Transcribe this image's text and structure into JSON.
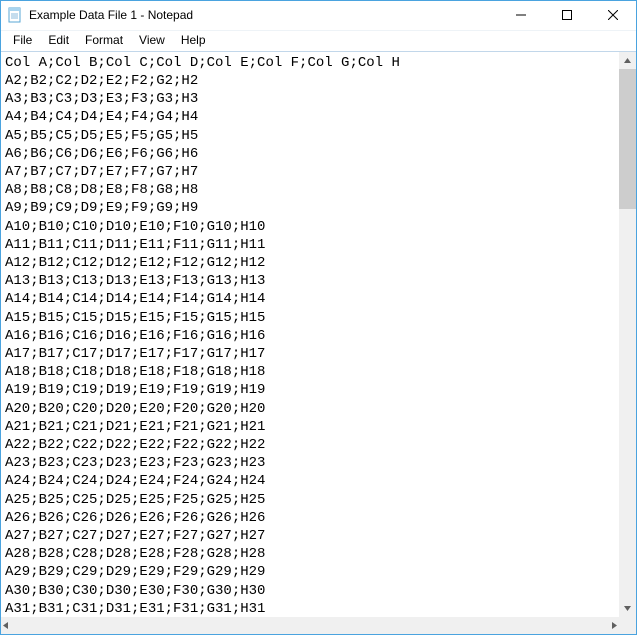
{
  "window": {
    "title": "Example Data File 1 - Notepad"
  },
  "menu": {
    "file": "File",
    "edit": "Edit",
    "format": "Format",
    "view": "View",
    "help": "Help"
  },
  "document": {
    "header": "Col A;Col B;Col C;Col D;Col E;Col F;Col G;Col H",
    "rows": [
      "A2;B2;C2;D2;E2;F2;G2;H2",
      "A3;B3;C3;D3;E3;F3;G3;H3",
      "A4;B4;C4;D4;E4;F4;G4;H4",
      "A5;B5;C5;D5;E5;F5;G5;H5",
      "A6;B6;C6;D6;E6;F6;G6;H6",
      "A7;B7;C7;D7;E7;F7;G7;H7",
      "A8;B8;C8;D8;E8;F8;G8;H8",
      "A9;B9;C9;D9;E9;F9;G9;H9",
      "A10;B10;C10;D10;E10;F10;G10;H10",
      "A11;B11;C11;D11;E11;F11;G11;H11",
      "A12;B12;C12;D12;E12;F12;G12;H12",
      "A13;B13;C13;D13;E13;F13;G13;H13",
      "A14;B14;C14;D14;E14;F14;G14;H14",
      "A15;B15;C15;D15;E15;F15;G15;H15",
      "A16;B16;C16;D16;E16;F16;G16;H16",
      "A17;B17;C17;D17;E17;F17;G17;H17",
      "A18;B18;C18;D18;E18;F18;G18;H18",
      "A19;B19;C19;D19;E19;F19;G19;H19",
      "A20;B20;C20;D20;E20;F20;G20;H20",
      "A21;B21;C21;D21;E21;F21;G21;H21",
      "A22;B22;C22;D22;E22;F22;G22;H22",
      "A23;B23;C23;D23;E23;F23;G23;H23",
      "A24;B24;C24;D24;E24;F24;G24;H24",
      "A25;B25;C25;D25;E25;F25;G25;H25",
      "A26;B26;C26;D26;E26;F26;G26;H26",
      "A27;B27;C27;D27;E27;F27;G27;H27",
      "A28;B28;C28;D28;E28;F28;G28;H28",
      "A29;B29;C29;D29;E29;F29;G29;H29",
      "A30;B30;C30;D30;E30;F30;G30;H30",
      "A31;B31;C31;D31;E31;F31;G31;H31"
    ]
  }
}
